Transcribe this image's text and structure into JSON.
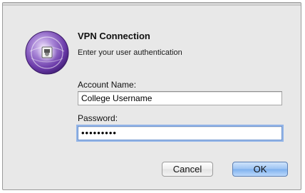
{
  "dialog": {
    "title": "VPN Connection",
    "subtitle": "Enter your user authentication",
    "icon": "vpn-network-icon"
  },
  "form": {
    "account_label": "Account Name:",
    "account_value": "College Username",
    "password_label": "Password:",
    "password_masked": "•••••••••"
  },
  "buttons": {
    "cancel_label": "Cancel",
    "ok_label": "OK"
  },
  "colors": {
    "accent": "#7eb0ee",
    "focus_ring": "#93b5e8",
    "icon_purple": "#7a4bb0"
  }
}
